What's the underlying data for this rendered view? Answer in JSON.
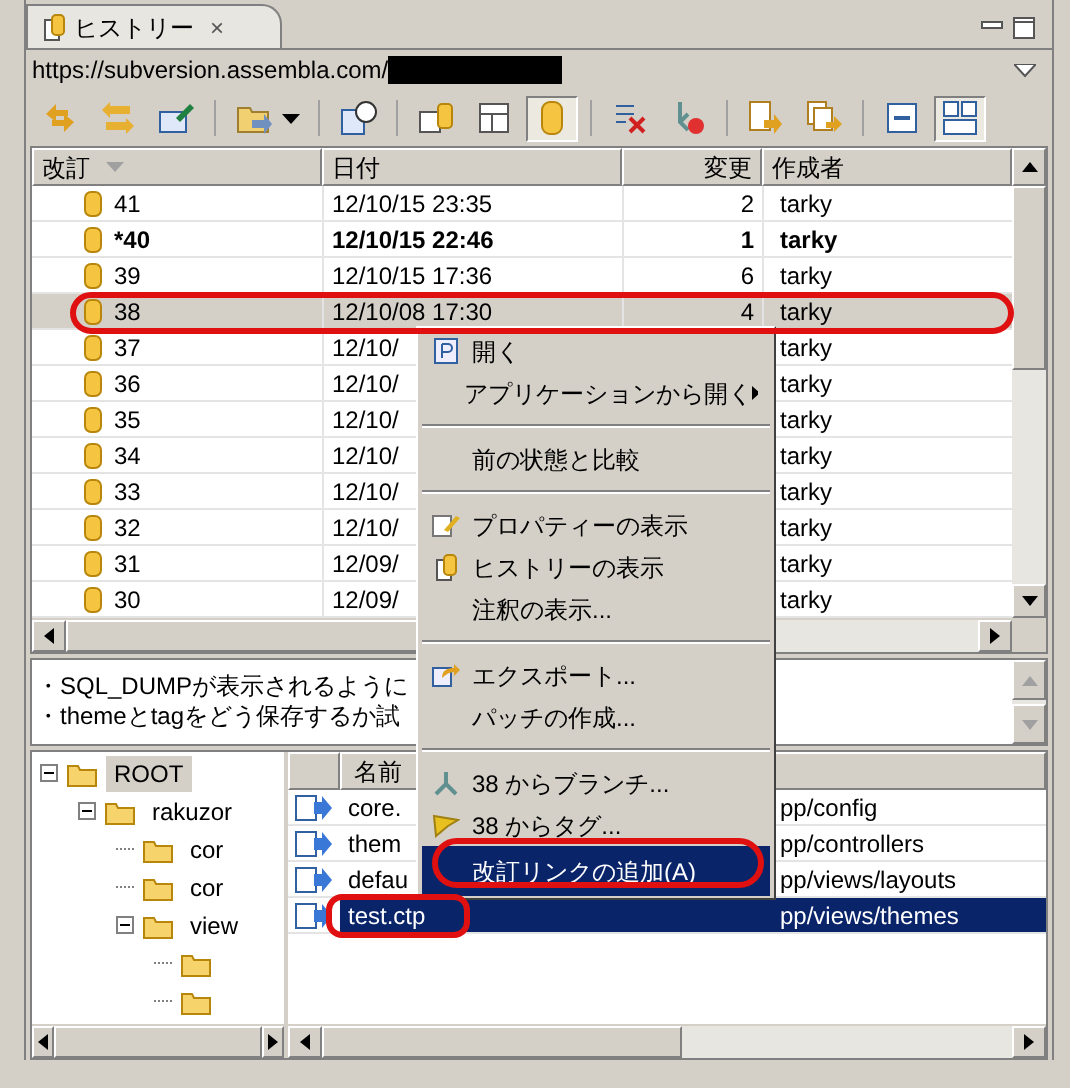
{
  "view_tab": {
    "title": "ヒストリー",
    "close": "×"
  },
  "url": {
    "text": "https://subversion.assembla.com/",
    "redacted": true
  },
  "toolbar": [
    {
      "kind": "button",
      "pressed": false
    },
    {
      "kind": "button",
      "pressed": false
    },
    {
      "kind": "button",
      "pressed": false
    },
    {
      "kind": "separator"
    },
    {
      "kind": "dropdown",
      "pressed": false
    },
    {
      "kind": "separator"
    },
    {
      "kind": "button",
      "pressed": false
    },
    {
      "kind": "separator"
    },
    {
      "kind": "button",
      "pressed": false
    },
    {
      "kind": "button",
      "pressed": false
    },
    {
      "kind": "button",
      "pressed": true
    },
    {
      "kind": "separator"
    },
    {
      "kind": "button",
      "pressed": false
    },
    {
      "kind": "button",
      "pressed": false
    },
    {
      "kind": "separator"
    },
    {
      "kind": "button",
      "pressed": false
    },
    {
      "kind": "button",
      "pressed": false
    },
    {
      "kind": "separator"
    },
    {
      "kind": "button",
      "pressed": false
    },
    {
      "kind": "button",
      "pressed": true
    }
  ],
  "history_table": {
    "columns": [
      "改訂",
      "日付",
      "変更",
      "作成者"
    ],
    "rows": [
      {
        "revision": "41",
        "date": "12/10/15 23:35",
        "changes": "2",
        "author": "tarky",
        "bold": false,
        "selected": false
      },
      {
        "revision": "*40",
        "date": "12/10/15 22:46",
        "changes": "1",
        "author": "tarky",
        "bold": true,
        "selected": false
      },
      {
        "revision": "39",
        "date": "12/10/15 17:36",
        "changes": "6",
        "author": "tarky",
        "bold": false,
        "selected": false
      },
      {
        "revision": "38",
        "date": "12/10/08 17:30",
        "changes": "4",
        "author": "tarky",
        "bold": false,
        "selected": true
      },
      {
        "revision": "37",
        "date": "12/10/",
        "author": "tarky",
        "bold": false,
        "selected": false
      },
      {
        "revision": "36",
        "date": "12/10/",
        "author": "tarky",
        "bold": false,
        "selected": false
      },
      {
        "revision": "35",
        "date": "12/10/",
        "author": "tarky",
        "bold": false,
        "selected": false
      },
      {
        "revision": "34",
        "date": "12/10/",
        "author": "tarky",
        "bold": false,
        "selected": false
      },
      {
        "revision": "33",
        "date": "12/10/",
        "author": "tarky",
        "bold": false,
        "selected": false
      },
      {
        "revision": "32",
        "date": "12/10/",
        "author": "tarky",
        "bold": false,
        "selected": false
      },
      {
        "revision": "31",
        "date": "12/09/",
        "author": "tarky",
        "bold": false,
        "selected": false
      },
      {
        "revision": "30",
        "date": "12/09/",
        "author": "tarky",
        "bold": false,
        "selected": false
      }
    ]
  },
  "comment": [
    "・SQL_DUMPが表示されるように",
    "・themeとtagをどう保存するか試"
  ],
  "tree": [
    {
      "label": "ROOT",
      "selected": true,
      "expanded": true,
      "children": [
        {
          "label": "rakuzor",
          "selected": false,
          "expanded": true,
          "children": [
            {
              "label": "cor",
              "selected": false
            },
            {
              "label": "cor",
              "selected": false
            },
            {
              "label": "view",
              "selected": false,
              "expanded": true,
              "children": [
                {
                  "kind": "folder"
                },
                {
                  "kind": "folder"
                }
              ]
            }
          ]
        }
      ]
    }
  ],
  "files_table": {
    "columns": [
      "名前"
    ],
    "rows": [
      {
        "name": "core.",
        "path": "pp/config",
        "selected": false
      },
      {
        "name": "them",
        "path": "pp/controllers",
        "selected": false
      },
      {
        "name": "defau",
        "path": "pp/views/layouts",
        "selected": false
      },
      {
        "name": "test.ctp",
        "path": "pp/views/themes",
        "selected": true
      }
    ]
  },
  "context_menu": [
    {
      "kind": "item",
      "label": "開く",
      "highlighted": false
    },
    {
      "kind": "item",
      "label": "アプリケーションから開く",
      "submenu": true,
      "highlighted": false
    },
    {
      "kind": "separator"
    },
    {
      "kind": "item",
      "label": "前の状態と比較",
      "highlighted": false
    },
    {
      "kind": "separator"
    },
    {
      "kind": "item",
      "label": "プロパティーの表示",
      "highlighted": false
    },
    {
      "kind": "item",
      "label": "ヒストリーの表示",
      "highlighted": false
    },
    {
      "kind": "item",
      "label": "注釈の表示...",
      "highlighted": false
    },
    {
      "kind": "separator"
    },
    {
      "kind": "item",
      "label": "エクスポート...",
      "highlighted": false
    },
    {
      "kind": "item",
      "label": "パッチの作成...",
      "highlighted": false
    },
    {
      "kind": "separator"
    },
    {
      "kind": "item",
      "label": "38 からブランチ...",
      "highlighted": false
    },
    {
      "kind": "item",
      "label": "38 からタグ...",
      "highlighted": false
    },
    {
      "kind": "item",
      "label": "改訂リンクの追加(A)",
      "highlighted": true
    }
  ]
}
